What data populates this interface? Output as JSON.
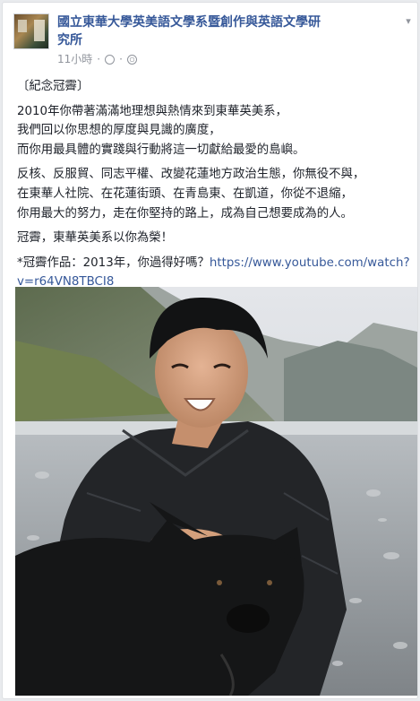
{
  "page": {
    "name": "國立東華大學英美語文學系暨創作與英語文學研究所",
    "name_line1": "國立東華大學英美語文學系暨創作與英語文學研",
    "name_line2": "究所",
    "time": "11小時",
    "dot": "·",
    "clock_icon": "clock-icon",
    "audience_icon": "globe-icon",
    "options_icon": "chevron-down-icon"
  },
  "post": {
    "tag": "〔紀念冠霽〕",
    "para1": [
      "2010年你帶著滿滿地理想與熱情來到東華英美系，",
      "我們回以你思想的厚度與見識的廣度，",
      "而你用最具體的實踐與行動將這一切獻給最愛的島嶼。"
    ],
    "para2": [
      "反核、反服貿、同志平權、改變花蓮地方政治生態，你無役不與，",
      "在東華人社院、在花蓮街頭、在青島東、在凱道，你從不退縮，",
      "你用最大的努力，走在你堅持的路上，成為自己想要成為的人。"
    ],
    "para3": "冠霽，東華英美系以你為榮！",
    "para4_prefix": "*冠霽作品：2013年，你過得好嗎？",
    "link": "https://www.youtube.com/watch?v=r64VN8TBCI8",
    "link_line1": "https://www.youtube.com/watch?",
    "link_line2": "v=r64VN8TBCI8"
  },
  "colors": {
    "link": "#365899",
    "text": "#1d2129",
    "meta": "#90949c"
  }
}
